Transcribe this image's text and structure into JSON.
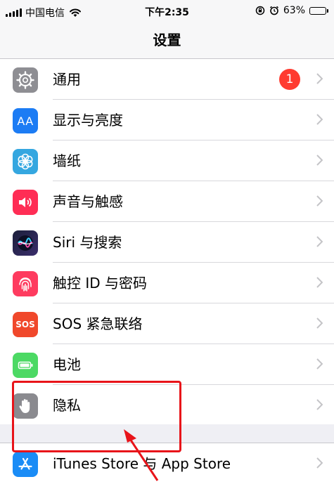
{
  "status_bar": {
    "carrier": "中国电信",
    "time": "下午2:35",
    "battery_percent": "63%",
    "battery_level": 0.63
  },
  "nav": {
    "title": "设置"
  },
  "settings": {
    "general": {
      "label": "通用",
      "badge": "1",
      "icon": "gear-icon"
    },
    "display": {
      "label": "显示与亮度",
      "icon": "text-size-icon",
      "icon_text": "AA"
    },
    "wallpaper": {
      "label": "墙纸",
      "icon": "flower-icon"
    },
    "sounds": {
      "label": "声音与触感",
      "icon": "speaker-icon"
    },
    "siri": {
      "label": "Siri 与搜索",
      "icon": "siri-icon"
    },
    "touchid": {
      "label": "触控 ID 与密码",
      "icon": "fingerprint-icon"
    },
    "sos": {
      "label": "SOS 紧急联络",
      "icon": "sos-icon",
      "icon_text": "SOS"
    },
    "battery": {
      "label": "电池",
      "icon": "battery-icon"
    },
    "privacy": {
      "label": "隐私",
      "icon": "hand-icon"
    },
    "itunes": {
      "label": "iTunes Store 与 App Store",
      "icon": "app-store-icon"
    }
  },
  "colors": {
    "highlight": "#e8141a",
    "badge": "#ff3b30"
  }
}
